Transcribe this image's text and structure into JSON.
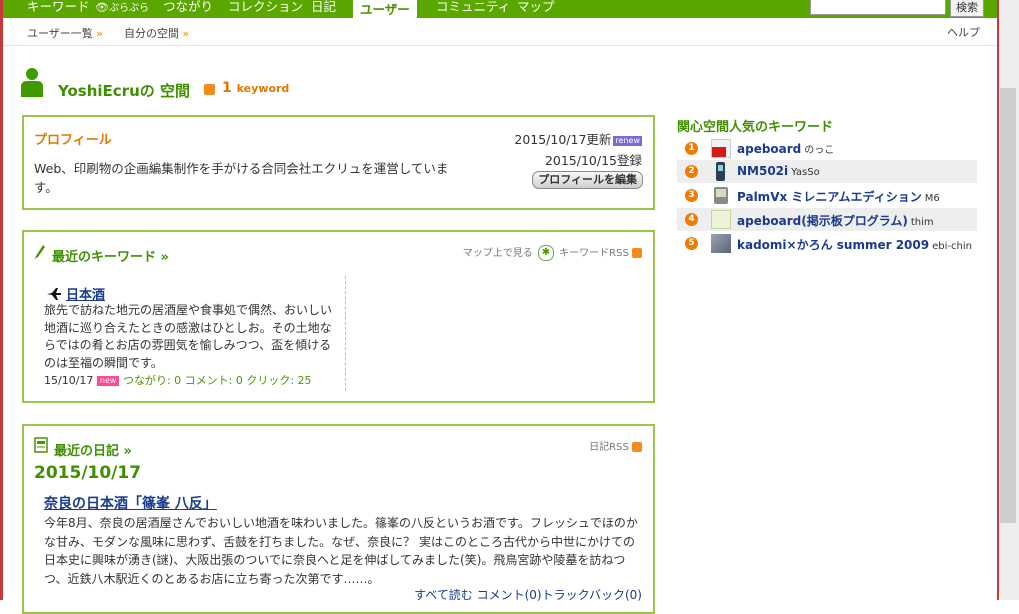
{
  "topnav": {
    "items": [
      "キーワード",
      "ぷらぷら",
      "つながり",
      "コレクション",
      "日記",
      "ユーザー",
      "コミュニティ",
      "マップ"
    ],
    "active": "ユーザー",
    "search_button": "検索",
    "search_value": ""
  },
  "subnav": {
    "crumbs": [
      "ユーザー一覧",
      "自分の空間"
    ],
    "arrow": "»",
    "help": "ヘルプ"
  },
  "page": {
    "title": "YoshiEcruの 空間",
    "keyword_count": "1",
    "keyword_word": "keyword"
  },
  "profile": {
    "title": "プロフィール",
    "updated": "2015/10/17更新",
    "renew_badge": "renew",
    "registered": "2015/10/15登録",
    "edit_button": "プロフィールを編集",
    "text": "Web、印刷物の企画編集制作を手がける合同会社エクリュを運営しています。"
  },
  "keywords": {
    "title": "最近のキーワード",
    "arrow": "»",
    "map_link": "マップ上で見る",
    "rss_link": "キーワードRSS",
    "item": {
      "title": "日本酒",
      "desc": "旅先で訪ねた地元の居酒屋や食事処で偶然、おいしい地酒に巡り合えたときの感激はひとしお。その土地ならではの肴とお店の雰囲気を愉しみつつ、盃を傾けるのは至福の瞬間です。",
      "date": "15/10/17",
      "new_badge": "new",
      "connections": "つながり: 0",
      "comments": "コメント: 0",
      "clicks": "クリック: 25"
    }
  },
  "diary": {
    "title": "最近の日記",
    "arrow": "»",
    "rss_link": "日記RSS",
    "date": "2015/10/17",
    "entry_title": "奈良の日本酒「篠峯 八反」",
    "body": "今年8月、奈良の居酒屋さんでおいしい地酒を味わいました。篠峯の八反というお酒です。フレッシュでほのかな甘み、モダンな風味に思わず、舌鼓を打ちました。なぜ、奈良に？ 実はこのところ古代から中世にかけての日本史に興味が湧き(謎)、大阪出張のついでに奈良へと足を伸ばしてみました(笑)。飛鳥宮跡や陵墓を訪ねつつ、近鉄八木駅近くのとあるお店に立ち寄った次第です……。",
    "read_all": "すべて読む",
    "comments": "コメント(0)",
    "trackbacks": "トラックバック(0)"
  },
  "popular": {
    "title": "関心空間人気のキーワード",
    "items": [
      {
        "num": "1",
        "keyword": "apeboard",
        "user": "のっこ",
        "icon": "apeboard-logo-icon"
      },
      {
        "num": "2",
        "keyword": "NM502i",
        "user": "YasSo",
        "icon": "phone-icon"
      },
      {
        "num": "3",
        "keyword": "PalmVx ミレニアムエディション",
        "user": "M6",
        "icon": "pda-icon"
      },
      {
        "num": "4",
        "keyword": "apeboard(掲示板プログラム)",
        "user": "thim",
        "icon": "board-thumb-icon"
      },
      {
        "num": "5",
        "keyword": "kadomi×かろん summer 2009",
        "user": "ebi-chin",
        "icon": "photo-thumb-icon"
      }
    ]
  },
  "colors": {
    "nav_green": "#5aa700",
    "title_green": "#3f8f00",
    "orange": "#e07800",
    "link_blue": "#1a3a8c",
    "frame_red": "#c8393b"
  }
}
